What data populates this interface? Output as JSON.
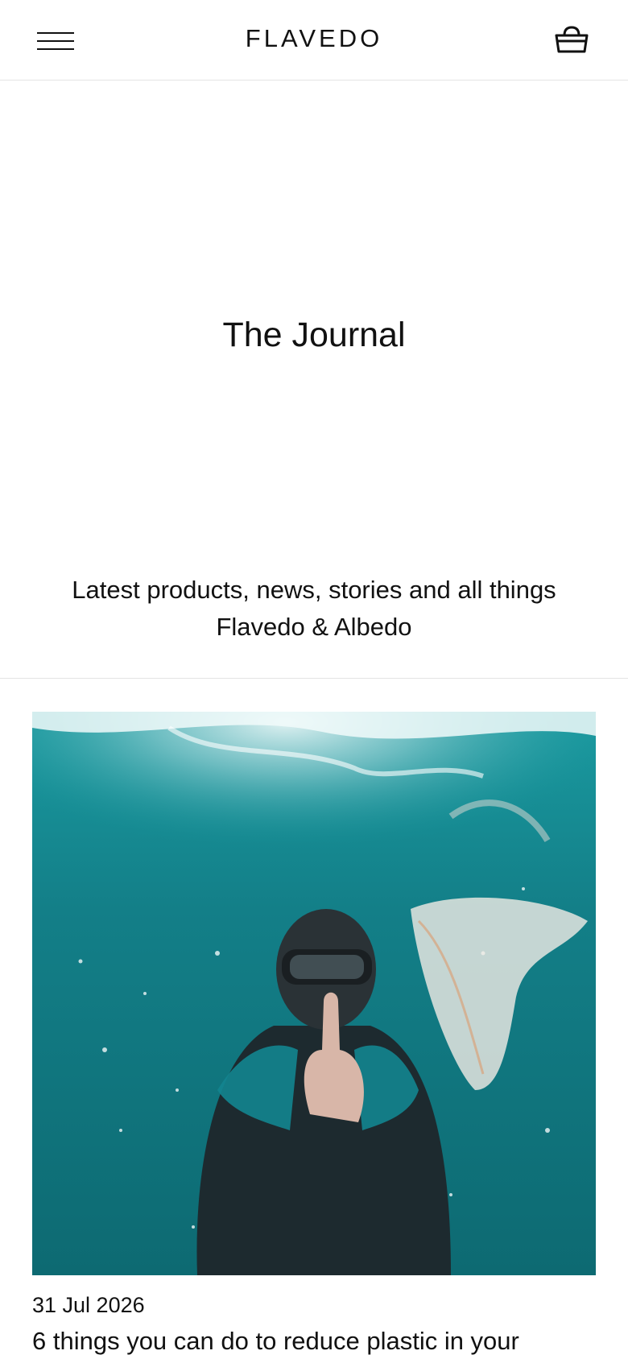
{
  "header": {
    "brand": "FLAVEDO",
    "menu_icon": "hamburger-menu-icon",
    "cart_icon": "shopping-basket-icon"
  },
  "hero": {
    "title": "The Journal"
  },
  "intro": {
    "line1": "Latest products, news, stories and all things",
    "line2": "Flavedo & Albedo"
  },
  "articles": [
    {
      "date": "31 Jul 2026",
      "title": "6 things you can do to reduce plastic in your",
      "image_subject": "underwater-snorkeler-with-plastic-bag"
    }
  ],
  "colors": {
    "text": "#111111",
    "divider": "#e3e3e3",
    "water": "#117e86"
  }
}
